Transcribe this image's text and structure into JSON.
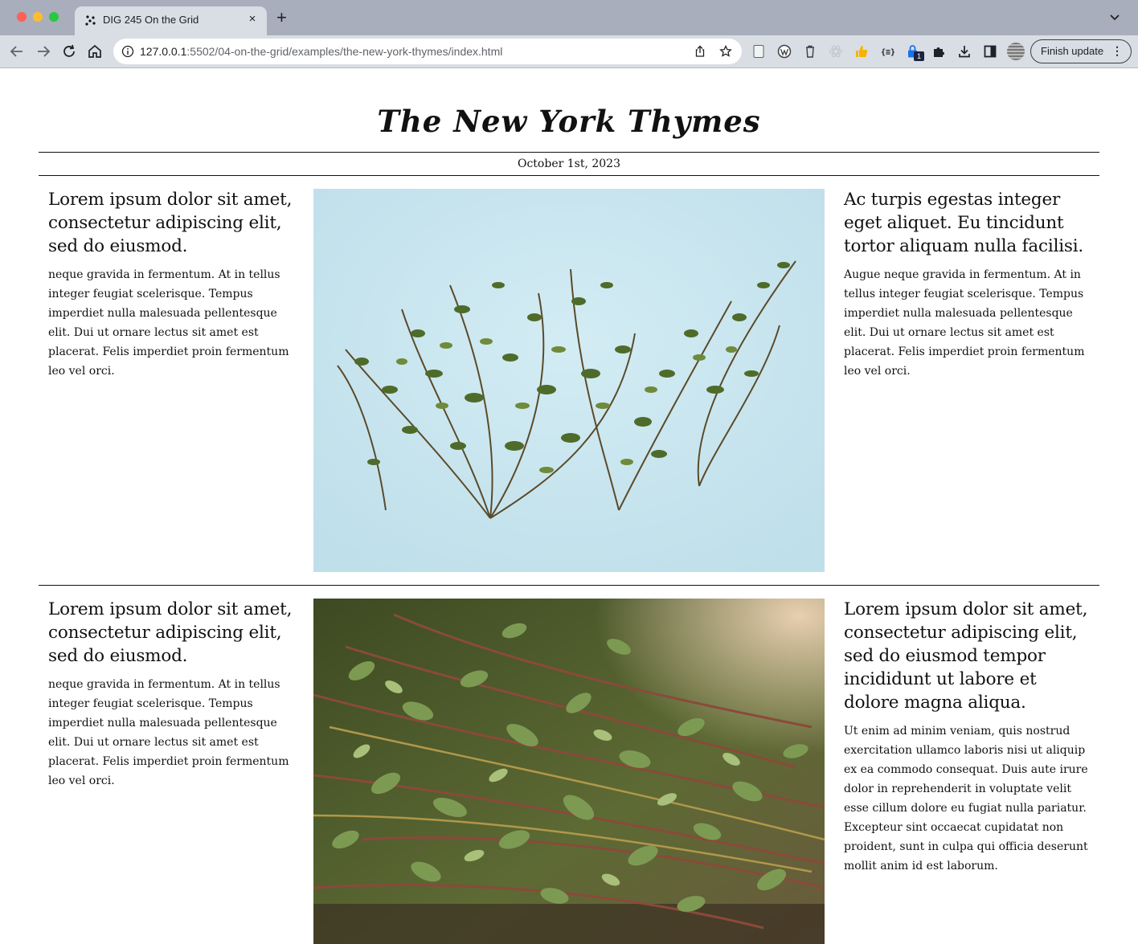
{
  "browser": {
    "tab_title": "DIG 245 On the Grid",
    "tab_close": "×",
    "new_tab": "+",
    "url_host": "127.0.0.1",
    "url_rest": ":5502/04-on-the-grid/examples/the-new-york-thymes/index.html",
    "extension_badge": "1",
    "update_button": "Finish update",
    "update_menu": "⋮",
    "icons": [
      "back-arrow-icon",
      "forward-arrow-icon",
      "reload-icon",
      "home-icon",
      "info-icon",
      "share-icon",
      "star-icon",
      "puzzle-icon",
      "download-icon",
      "sidebar-icon"
    ],
    "colors": {
      "tabbar": "#a8aebb",
      "toolbar": "#d9dde4"
    }
  },
  "newspaper": {
    "masthead": "The New York Thymes",
    "date": "October 1st, 2023",
    "section1": {
      "left": {
        "headline": "Lorem ipsum dolor sit amet, consectetur adipiscing elit, sed do eiusmod.",
        "body": "neque gravida in fermentum. At in tellus integer feugiat scelerisque. Tempus imperdiet nulla malesuada pellentesque elit. Dui ut ornare lectus sit amet est placerat. Felis imperdiet proin fermentum leo vel orci."
      },
      "right": {
        "headline": "Ac turpis egestas integer eget aliquet. Eu tincidunt tortor aliquam nulla facilisi.",
        "body": "Augue neque gravida in fermentum. At in tellus integer feugiat scelerisque. Tempus imperdiet nulla malesuada pellentesque elit. Dui ut ornare lectus sit amet est placerat. Felis imperdiet proin fermentum leo vel orci."
      }
    },
    "section2": {
      "left": {
        "headline": "Lorem ipsum dolor sit amet, consectetur adipiscing elit, sed do eiusmod.",
        "body": "neque gravida in fermentum. At in tellus integer feugiat scelerisque. Tempus imperdiet nulla malesuada pellentesque elit. Dui ut ornare lectus sit amet est placerat. Felis imperdiet proin fermentum leo vel orci."
      },
      "right": {
        "headline": "Lorem ipsum dolor sit amet, consectetur adipiscing elit, sed do eiusmod tempor incididunt ut labore et dolore magna aliqua.",
        "body": "Ut enim ad minim veniam, quis nostrud exercitation ullamco laboris nisi ut aliquip ex ea commodo consequat. Duis aute irure dolor in reprehenderit in voluptate velit esse cillum dolore eu fugiat nulla pariatur. Excepteur sint occaecat cupidatat non proident, sunt in culpa qui officia deserunt mollit anim id est laborum."
      }
    }
  }
}
